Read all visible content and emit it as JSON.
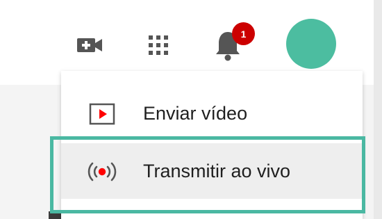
{
  "header": {
    "notification_count": "1",
    "icons": {
      "create_video": "video-plus-icon",
      "apps": "apps-grid-icon",
      "notifications": "bell-icon"
    }
  },
  "dropdown": {
    "items": [
      {
        "label": "Enviar vídeo",
        "icon": "upload-video-icon"
      },
      {
        "label": "Transmitir ao vivo",
        "icon": "live-broadcast-icon"
      }
    ]
  },
  "colors": {
    "avatar": "#4cbda0",
    "highlight_border": "#4ab8a2",
    "badge": "#cc0000",
    "icon_red": "#ff0000"
  }
}
